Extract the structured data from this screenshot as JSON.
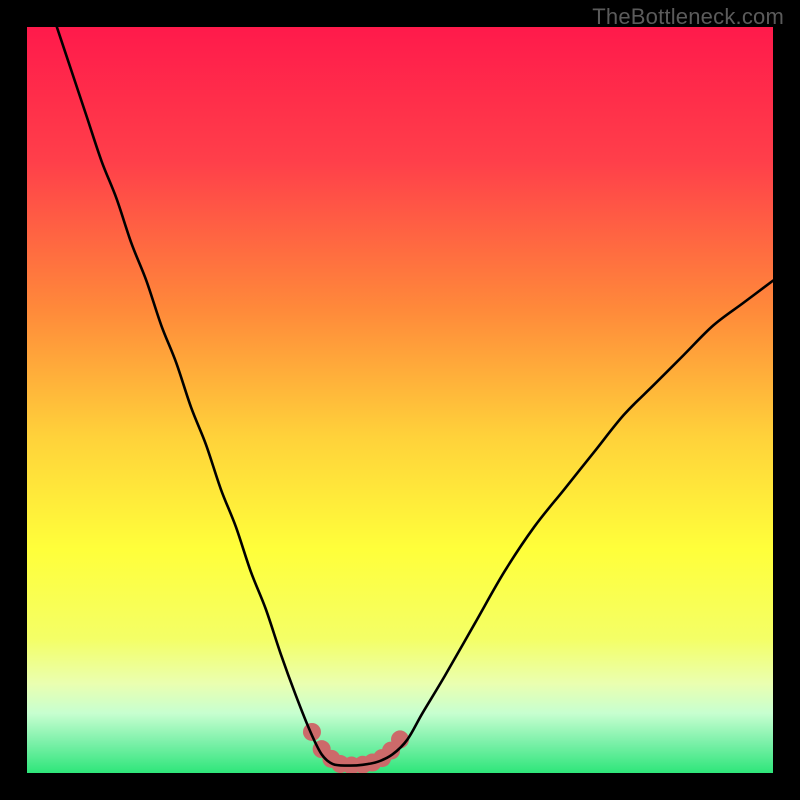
{
  "watermark": {
    "text": "TheBottleneck.com"
  },
  "colors": {
    "gradient_stops": [
      {
        "pct": 0,
        "color": "#ff1a4b"
      },
      {
        "pct": 18,
        "color": "#ff3f4a"
      },
      {
        "pct": 38,
        "color": "#ff8a3a"
      },
      {
        "pct": 55,
        "color": "#ffd23a"
      },
      {
        "pct": 70,
        "color": "#ffff3a"
      },
      {
        "pct": 82,
        "color": "#f4ff66"
      },
      {
        "pct": 88,
        "color": "#eaffb0"
      },
      {
        "pct": 92,
        "color": "#c7ffd0"
      },
      {
        "pct": 96,
        "color": "#7af0a8"
      },
      {
        "pct": 100,
        "color": "#2ee67a"
      }
    ],
    "curve": "#000000",
    "marker": "#cc6a6a"
  },
  "chart_data": {
    "type": "line",
    "title": "",
    "xlabel": "",
    "ylabel": "",
    "xlim": [
      0,
      100
    ],
    "ylim": [
      0,
      100
    ],
    "series": [
      {
        "name": "bottleneck-curve",
        "x": [
          4,
          6,
          8,
          10,
          12,
          14,
          16,
          18,
          20,
          22,
          24,
          26,
          28,
          30,
          32,
          34,
          36,
          38,
          39.5,
          41,
          43,
          45,
          47,
          49,
          51,
          53,
          56,
          60,
          64,
          68,
          72,
          76,
          80,
          84,
          88,
          92,
          96,
          100
        ],
        "y": [
          100,
          94,
          88,
          82,
          77,
          71,
          66,
          60,
          55,
          49,
          44,
          38,
          33,
          27,
          22,
          16,
          10.5,
          5.5,
          2.5,
          1.2,
          1.0,
          1.1,
          1.5,
          2.5,
          4.5,
          8,
          13,
          20,
          27,
          33,
          38,
          43,
          48,
          52,
          56,
          60,
          63,
          66
        ]
      }
    ],
    "markers": {
      "name": "trough-markers",
      "points": [
        {
          "x": 38.2,
          "y": 5.5
        },
        {
          "x": 39.5,
          "y": 3.2
        },
        {
          "x": 40.8,
          "y": 1.9
        },
        {
          "x": 42.0,
          "y": 1.2
        },
        {
          "x": 43.5,
          "y": 1.0
        },
        {
          "x": 45.0,
          "y": 1.1
        },
        {
          "x": 46.3,
          "y": 1.4
        },
        {
          "x": 47.6,
          "y": 2.0
        },
        {
          "x": 48.8,
          "y": 3.0
        },
        {
          "x": 50.0,
          "y": 4.5
        }
      ],
      "radius": 9
    }
  }
}
